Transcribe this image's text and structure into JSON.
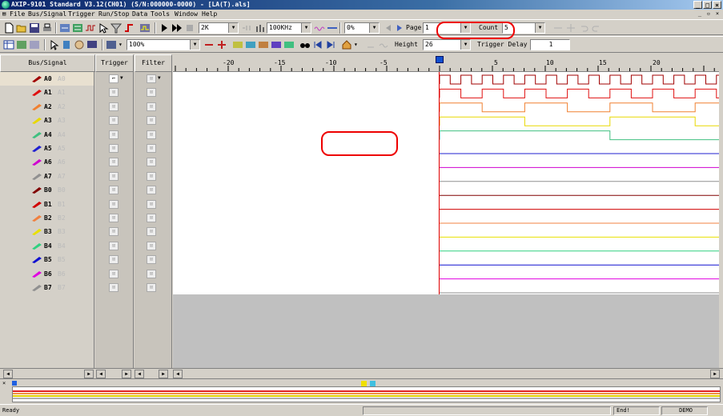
{
  "window": {
    "title": "AXIP-9101 Standard V3.12(CH01) (S/N:000000-0000) - [LA(T).als]"
  },
  "menu": [
    "File",
    "Bus/Signal",
    "Trigger",
    "Run/Stop",
    "Data",
    "Tools",
    "Window",
    "Help"
  ],
  "toolbar": {
    "zoom": "100%",
    "sample_depth": "2K",
    "sample_rate": "100KHz",
    "trigger_pos": "0%",
    "page_label": "Page",
    "page_value": "1",
    "count_label": "Count",
    "count_value": "5",
    "height_label": "Height",
    "height_value": "26",
    "trigger_delay_label": "Trigger Delay",
    "trigger_delay_value": "1"
  },
  "headers": {
    "bus_signal": "Bus/Signal",
    "trigger": "Trigger",
    "filter": "Filter"
  },
  "ruler": {
    "ticks": [
      "-20",
      "-15",
      "-10",
      "-5",
      "5",
      "10",
      "15",
      "20"
    ]
  },
  "signals": [
    {
      "name": "A0",
      "alias": "A0",
      "color": "#a00000"
    },
    {
      "name": "A1",
      "alias": "A1",
      "color": "#e01010"
    },
    {
      "name": "A2",
      "alias": "A2",
      "color": "#f08030"
    },
    {
      "name": "A3",
      "alias": "A3",
      "color": "#e8d800"
    },
    {
      "name": "A4",
      "alias": "A4",
      "color": "#40c080"
    },
    {
      "name": "A5",
      "alias": "A5",
      "color": "#2020d0"
    },
    {
      "name": "A6",
      "alias": "A6",
      "color": "#d000d0"
    },
    {
      "name": "A7",
      "alias": "A7",
      "color": "#909090"
    },
    {
      "name": "B0",
      "alias": "B0",
      "color": "#800000"
    },
    {
      "name": "B1",
      "alias": "B1",
      "color": "#d00000"
    },
    {
      "name": "B2",
      "alias": "B2",
      "color": "#f08040"
    },
    {
      "name": "B3",
      "alias": "B3",
      "color": "#e8e000"
    },
    {
      "name": "B4",
      "alias": "B4",
      "color": "#30d080"
    },
    {
      "name": "B5",
      "alias": "B5",
      "color": "#1010d0"
    },
    {
      "name": "B6",
      "alias": "B6",
      "color": "#e000e0"
    },
    {
      "name": "B7",
      "alias": "B7",
      "color": "#909090"
    }
  ],
  "status": {
    "ready": "Ready",
    "end": "End!",
    "mode": "DEMO"
  }
}
